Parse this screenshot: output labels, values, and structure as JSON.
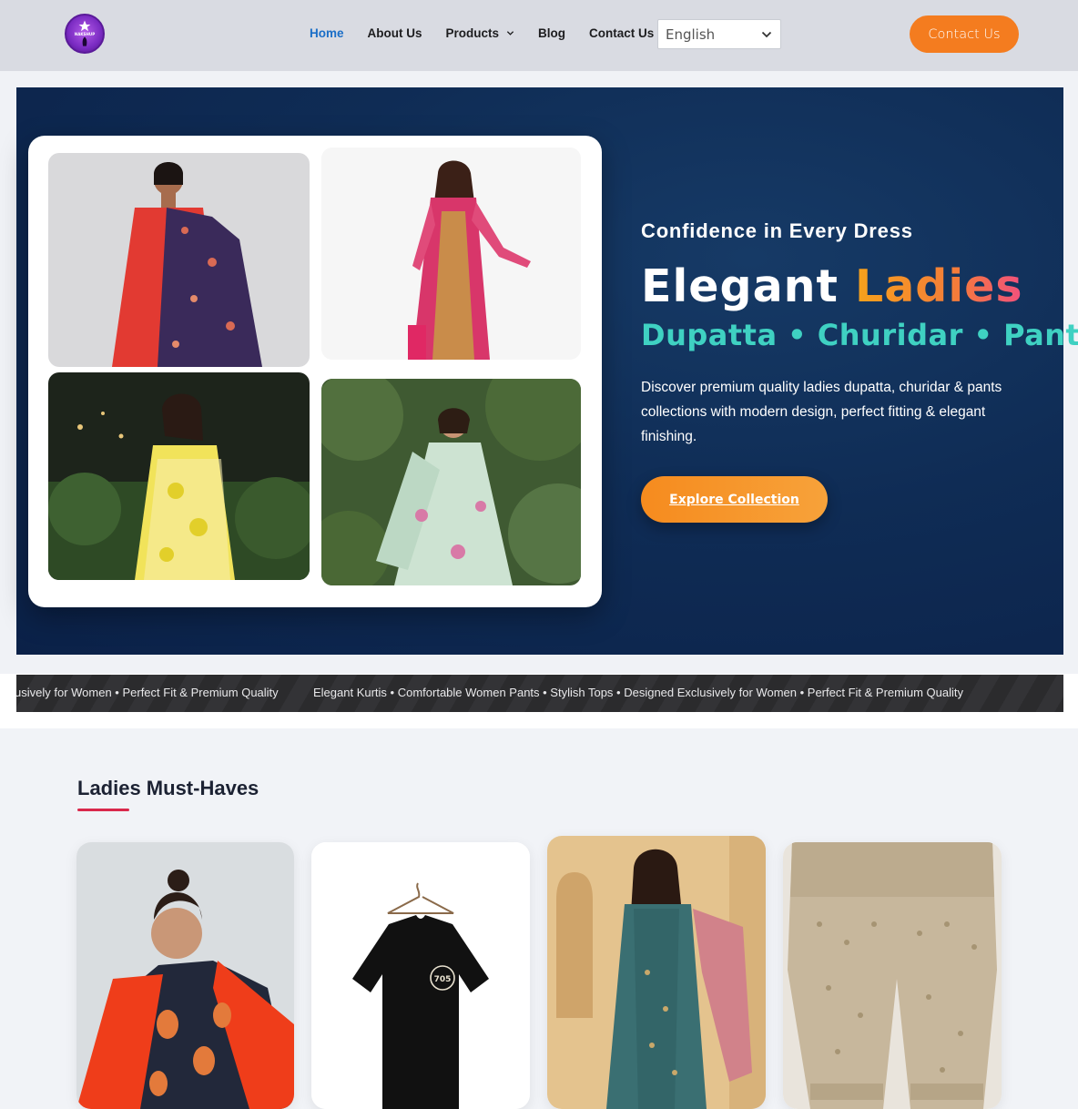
{
  "header": {
    "logo_text": "NAKSHUP",
    "nav": [
      {
        "label": "Home",
        "active": true
      },
      {
        "label": "About Us",
        "active": false
      },
      {
        "label": "Products",
        "active": false,
        "has_dropdown": true
      },
      {
        "label": "Blog",
        "active": false
      },
      {
        "label": "Contact Us",
        "active": false
      }
    ],
    "language": {
      "selected": "English",
      "icon": "chevron-down-icon"
    },
    "cta_label": "Contact Us"
  },
  "hero": {
    "tagline": "Confidence in Every Dress",
    "title_plain": "Elegant ",
    "title_accent": "Ladies",
    "subtitle": "Dupatta • Churidar • Pants",
    "description": "Discover premium quality ladies dupatta, churidar & pants collections with modern design, perfect fitting & elegant finishing.",
    "button_label": "Explore Collection",
    "photos": [
      {
        "alt": "woman in red anarkali with floral dupatta"
      },
      {
        "alt": "woman in pink embroidered churidar suit"
      },
      {
        "alt": "woman in yellow floral kurta"
      },
      {
        "alt": "woman in mint green dress with floral dupatta"
      }
    ]
  },
  "ticker": {
    "segment_partial": "usively for Women • Perfect Fit & Premium Quality",
    "segment_full": "Elegant Kurtis • Comfortable Women Pants • Stylish Tops • Designed Exclusively for Women • Perfect Fit & Premium Quality"
  },
  "musthaves": {
    "title": "Ladies Must-Haves",
    "cards": [
      {
        "alt": "woman in orange dupatta and leaf print kurta"
      },
      {
        "alt": "black t-shirt on hanger"
      },
      {
        "alt": "woman in teal kurta set with pink dupatta"
      },
      {
        "alt": "printed beige ladies pants"
      }
    ]
  },
  "colors": {
    "header_bg": "#d9dbe2",
    "nav_active": "#1a6ec7",
    "accent_orange": "#f47c1f",
    "hero_bg": "#0f2c55",
    "subtitle_teal": "#3fd1c2",
    "underline_red": "#d9284b"
  }
}
